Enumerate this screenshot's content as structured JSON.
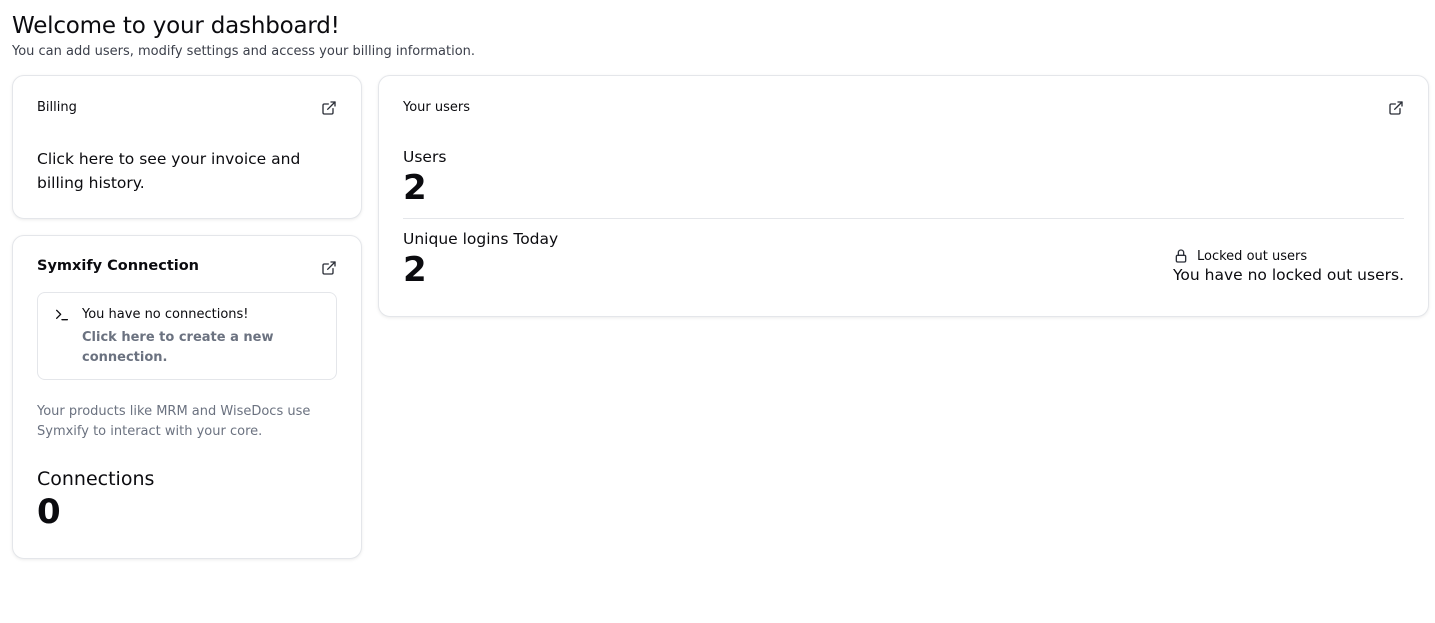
{
  "header": {
    "title": "Welcome to your dashboard!",
    "subtitle": "You can add users, modify settings and access your billing information."
  },
  "billing": {
    "title": "Billing",
    "icon": "external-link-icon",
    "text": "Click here to see your invoice and billing history."
  },
  "symxify": {
    "title": "Symxify Connection",
    "icon": "external-link-icon",
    "empty_state": {
      "icon": "terminal-icon",
      "title": "You have no connections!",
      "link": "Click here to create a new connection."
    },
    "description": "Your products like MRM and WiseDocs use Symxify to interact with your core.",
    "connections_label": "Connections",
    "connections_count": "0"
  },
  "users": {
    "title": "Your users",
    "icon": "external-link-icon",
    "users_label": "Users",
    "users_count": "2",
    "logins_label": "Unique logins Today",
    "logins_count": "2",
    "locked": {
      "icon": "lock-icon",
      "title": "Locked out users",
      "text": "You have no locked out users."
    }
  },
  "colors": {
    "text": "#0b0b0f",
    "muted": "#6b7280",
    "border": "#e4e6ea"
  }
}
